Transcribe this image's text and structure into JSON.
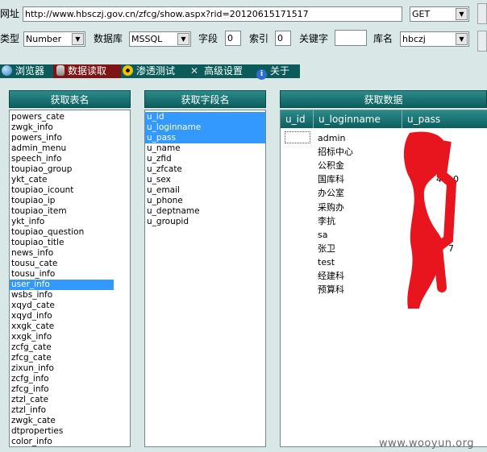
{
  "toolbar": {
    "url_label": "网址",
    "url_value": "http://www.hbsczj.gov.cn/zfcg/show.aspx?rid=20120615171517",
    "method_value": "GET",
    "type_label": "类型",
    "type_value": "Number",
    "db_label": "数据库",
    "db_value": "MSSQL",
    "field_label": "字段",
    "field_value": "0",
    "index_label": "索引",
    "index_value": "0",
    "keyword_label": "关键字",
    "keyword_value": "",
    "dbname_label": "库名",
    "dbname_value": "hbczj"
  },
  "tabs": [
    {
      "label": "浏览器",
      "icon": "globe-icon"
    },
    {
      "label": "数据读取",
      "icon": "database-icon"
    },
    {
      "label": "渗透测试",
      "icon": "radiation-icon"
    },
    {
      "label": "高级设置",
      "icon": "tools-icon"
    },
    {
      "label": "关于",
      "icon": "info-icon"
    }
  ],
  "panels": {
    "tables_title": "获取表名",
    "fields_title": "获取字段名",
    "data_title": "获取数据"
  },
  "tables": [
    "powers_cate",
    "zwgk_info",
    "powers_info",
    "admin_menu",
    "speech_info",
    "toupiao_group",
    "ykt_cate",
    "toupiao_icount",
    "toupiao_ip",
    "toupiao_item",
    "ykt_info",
    "toupiao_question",
    "toupiao_title",
    "news_info",
    "tousu_cate",
    "tousu_info",
    "user_info",
    "wsbs_info",
    "xqyd_cate",
    "xqyd_info",
    "xxgk_cate",
    "xxgk_info",
    "zcfg_cate",
    "zfcg_cate",
    "zixun_info",
    "zcfg_info",
    "zfcg_info",
    "ztzl_cate",
    "ztzl_info",
    "zwgk_cate",
    "dtproperties",
    "color_info"
  ],
  "selected_table": "user_info",
  "fields": [
    "u_id",
    "u_loginname",
    "u_pass",
    "u_name",
    "u_zfid",
    "u_zfcate",
    "u_sex",
    "u_email",
    "u_phone",
    "u_deptname",
    "u_groupid"
  ],
  "selected_fields": [
    "u_id",
    "u_loginname",
    "u_pass"
  ],
  "grid": {
    "columns": [
      "u_id",
      "u_loginname",
      "u_pass"
    ],
    "rows": [
      {
        "loginname": "admin",
        "pass": ""
      },
      {
        "loginname": "招标中心",
        "pass": ""
      },
      {
        "loginname": "公积金",
        "pass": ""
      },
      {
        "loginname": "国库科",
        "pass": "4110"
      },
      {
        "loginname": "办公室",
        "pass": ""
      },
      {
        "loginname": "采购办",
        "pass": ""
      },
      {
        "loginname": "李抗",
        "pass": ""
      },
      {
        "loginname": "sa",
        "pass": ""
      },
      {
        "loginname": "张卫",
        "pass": "7"
      },
      {
        "loginname": "test",
        "pass": ""
      },
      {
        "loginname": "经建科",
        "pass": ""
      },
      {
        "loginname": "预算科",
        "pass": ""
      }
    ]
  },
  "watermark": "www.wooyun.org",
  "colors": {
    "tab_bar": "#0b5b5b",
    "active_tab": "#7f1414",
    "selection": "#3399ff",
    "redaction": "#e8141e"
  }
}
